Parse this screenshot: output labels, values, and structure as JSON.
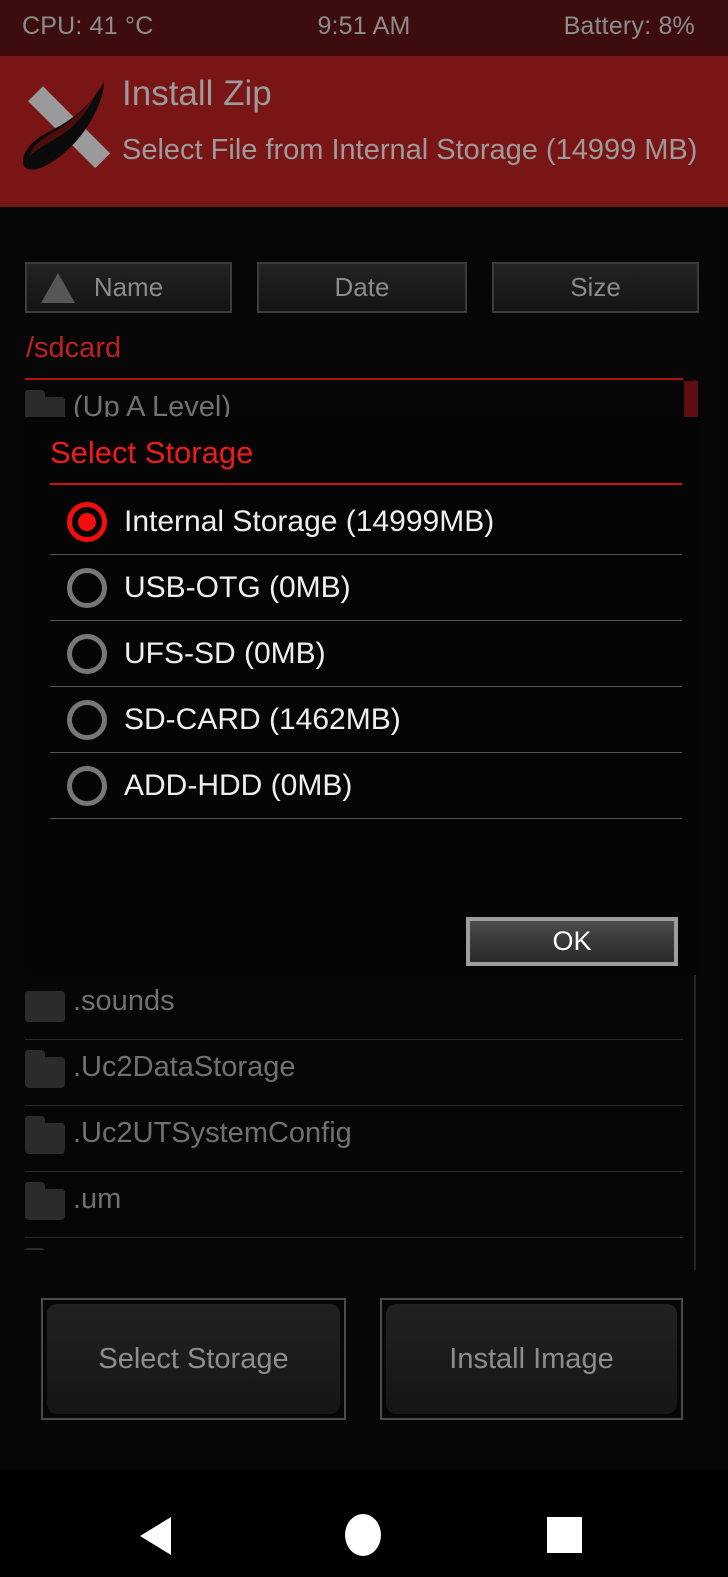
{
  "status_bar": {
    "cpu": "CPU: 41 °C",
    "time": "9:51 AM",
    "battery": "Battery: 8%"
  },
  "title_bar": {
    "logo_icon": "twrp-logo-icon",
    "title": "Install Zip",
    "subtitle": "Select File from Internal Storage (14999 MB)"
  },
  "sort_bar": {
    "sort_arrow_icon": "sort-ascending-triangle-icon",
    "name_label": "Name",
    "date_label": "Date",
    "size_label": "Size"
  },
  "file_browser": {
    "path": "/sdcard",
    "rows": [
      {
        "icon": "folder-icon",
        "name": "(Up A Level)"
      },
      {
        "icon": "file-icon",
        "name": ".sounds"
      },
      {
        "icon": "folder-icon",
        "name": ".Uc2DataStorage"
      },
      {
        "icon": "folder-icon",
        "name": ".Uc2UTSystemConfig"
      },
      {
        "icon": "folder-icon",
        "name": ".um"
      }
    ],
    "scrollbar_icon": "vertical-scrollbar"
  },
  "dialog": {
    "title": "Select Storage",
    "options": [
      {
        "label": "Internal Storage (14999MB)",
        "selected": true
      },
      {
        "label": "USB-OTG (0MB)",
        "selected": false
      },
      {
        "label": "UFS-SD (0MB)",
        "selected": false
      },
      {
        "label": "SD-CARD (1462MB)",
        "selected": false
      },
      {
        "label": "ADD-HDD (0MB)",
        "selected": false
      }
    ],
    "ok_label": "OK"
  },
  "actions": {
    "select_storage_label": "Select Storage",
    "install_image_label": "Install Image"
  },
  "nav_bar": {
    "back_icon": "back-triangle-icon",
    "home_icon": "home-circle-icon",
    "recents_icon": "recents-square-icon"
  },
  "colors": {
    "accent_red": "#ef1b1b",
    "title_bar_red": "#7a1515",
    "status_bar_red": "#3d0c0c",
    "text_gray": "#8c8c8c",
    "background": "#060606"
  }
}
